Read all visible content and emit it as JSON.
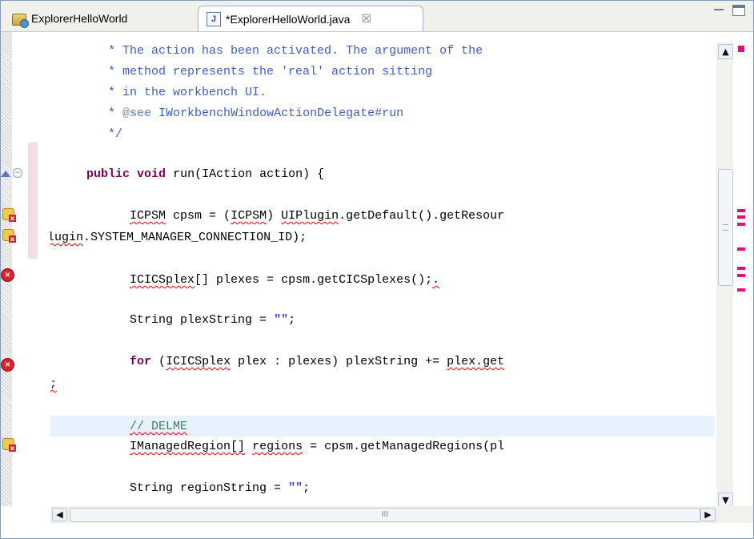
{
  "tabs": [
    {
      "label": "ExplorerHelloWorld",
      "icon": "project-icon"
    },
    {
      "label": "*ExplorerHelloWorld.java",
      "icon": "java-file-icon",
      "close": "☒"
    }
  ],
  "code": {
    "l1": "* The action has been activated. The argument of the",
    "l2": "* method represents the 'real' action sitting",
    "l3": "* in the workbench UI.",
    "l4_a": "* ",
    "l4_b": "@see",
    "l4_c": " IWorkbenchWindowActionDelegate#run",
    "l5": "*/",
    "l6_kw1": "public",
    "l6_kw2": "void",
    "l6_rest": " run(IAction action) {",
    "l7_t1": "ICPSM",
    "l7_t2": " cpsm = (",
    "l7_t3": "ICPSM",
    "l7_t4": ") ",
    "l7_t5": "UIPlugin",
    "l7_t6": ".getDefault().getResour",
    "l8_t1": "(",
    "l8_t2": "UIPlugin",
    "l8_t3": ".SYSTEM_MANAGER_CONNECTION_ID);",
    "l9_t1": "ICICSplex",
    "l9_t2": "[] plexes = cpsm.getCICSplexes();",
    "l9_t3": ".",
    "l10_a": "String plexString = ",
    "l10_b": "\"\"",
    "l10_c": ";",
    "l11_kw": "for",
    "l11_t1": " (",
    "l11_t2": "ICICSplex",
    "l11_t3": " plex : plexes) plexString += ",
    "l11_t4": "plex.get",
    "l12": "\";",
    "l13": "// DELME",
    "l14_t1": "IManagedRegion[]",
    "l14_t2": " ",
    "l14_t3": "regions",
    "l14_t4": " = cpsm.getManagedRegions(pl",
    "l15_a": "String regionString = ",
    "l15_b": "\"\"",
    "l15_c": ";"
  },
  "scroll": {
    "up": "▲",
    "down": "▼",
    "left": "◀",
    "right": "▶",
    "grip": "III"
  },
  "colors": {
    "keyword": "#7f0055",
    "javadoc": "#3f5fbf",
    "string": "#2a00ff",
    "comment": "#3f7f5f",
    "error": "#ff0000",
    "highlight": "#e8f2fe"
  }
}
